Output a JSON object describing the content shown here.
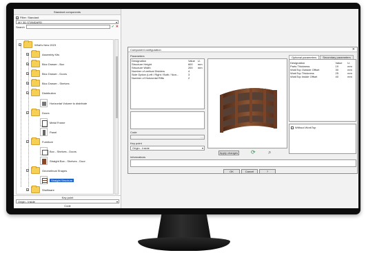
{
  "left_panel": {
    "title": "Standard components",
    "filter_label": "Filter: Standard",
    "collection_select": "MY 3D STANDARD",
    "search_label": "Search",
    "tree": {
      "root": "What's New 2023",
      "nodes": [
        "Assembly Kits",
        "Bloc Drawer - Box",
        "Bloc Drawer - Doors",
        "Bloc Drawer - Shelves",
        "Distribution",
        "Horizontal Volume to distribute",
        "Doors",
        "Metal Frame",
        "Panel",
        "Furniture",
        "Box - Shelves - Doors",
        "Straight Box - Shelves - Door",
        "Geometrical Shapes",
        "Straight Structure",
        "Shelfware"
      ]
    },
    "keypoint_label": "Key point",
    "keypoint_value": "Origin - Inside",
    "code_label": "Code"
  },
  "dialog": {
    "title": "Component configuration",
    "close_glyph": "✕",
    "parameters_label": "Parameters",
    "param_headers": [
      "Designation",
      "Value",
      "U."
    ],
    "params": [
      [
        "Structure Height",
        "600",
        "mm"
      ],
      [
        "Structure Width",
        "200",
        "mm"
      ],
      [
        "Number of vertical Dividers",
        "4",
        ""
      ],
      [
        "Side Option (Left / Right / Both / Non...",
        "3",
        ""
      ],
      [
        "Number of Horizontal Rifts",
        "2",
        ""
      ]
    ],
    "code_label": "Code",
    "keypoint_label": "Key point",
    "keypoint_value": "Origin - Inside",
    "information_label": "Informations",
    "apply_button": "Apply changes",
    "tab_optional": "Optional parameters",
    "tab_secondary": "Secondary parameters",
    "opt_headers": [
      "Designation",
      "Value",
      "U."
    ],
    "opt_params": [
      [
        "Parts Thickness",
        "19",
        "mm"
      ],
      [
        "WorkTop Outside Offset",
        "30",
        "mm"
      ],
      [
        "WorkTop Thickness",
        "25",
        "mm"
      ],
      [
        "WorkTop Inside Offset",
        "40",
        "mm"
      ]
    ],
    "without_worktop_label": "Without WorkTop",
    "ok_button": "OK",
    "cancel_button": "Cancel",
    "help_button": "?"
  },
  "colors": {
    "selection": "#1e63c9",
    "folder": "#f6cf55",
    "wood": "#6b3a22",
    "monitor": "#0d0d0d"
  }
}
